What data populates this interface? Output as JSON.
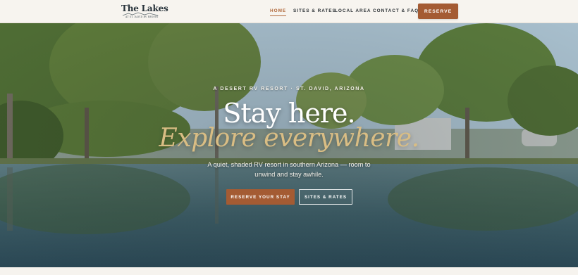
{
  "header": {
    "logo": {
      "title": "The Lakes",
      "subtitle": "AT ST. DAVID RV RESORT"
    },
    "nav": [
      {
        "label": "HOME",
        "active": true
      },
      {
        "label": "SITES & RATES"
      },
      {
        "label": "LOCAL AREA"
      },
      {
        "label": "CONTACT & FAQ"
      }
    ],
    "reserve_label": "RESERVE"
  },
  "hero": {
    "eyebrow": "A DESERT RV RESORT · ST. DAVID, ARIZONA",
    "headline": "Stay here.",
    "subheadline": "Explore everywhere.",
    "description": "A quiet, shaded RV resort in southern Arizona — room to unwind and stay awhile.",
    "primary_cta": "RESERVE YOUR STAY",
    "secondary_cta": "SITES & RATES"
  },
  "colors": {
    "accent": "#a45b33",
    "gold": "#d9bd84",
    "header_bg": "#f7f4ef",
    "nav_text": "#2f3438"
  },
  "icons": {
    "logo_graphic": "mountain-lake-icon"
  }
}
